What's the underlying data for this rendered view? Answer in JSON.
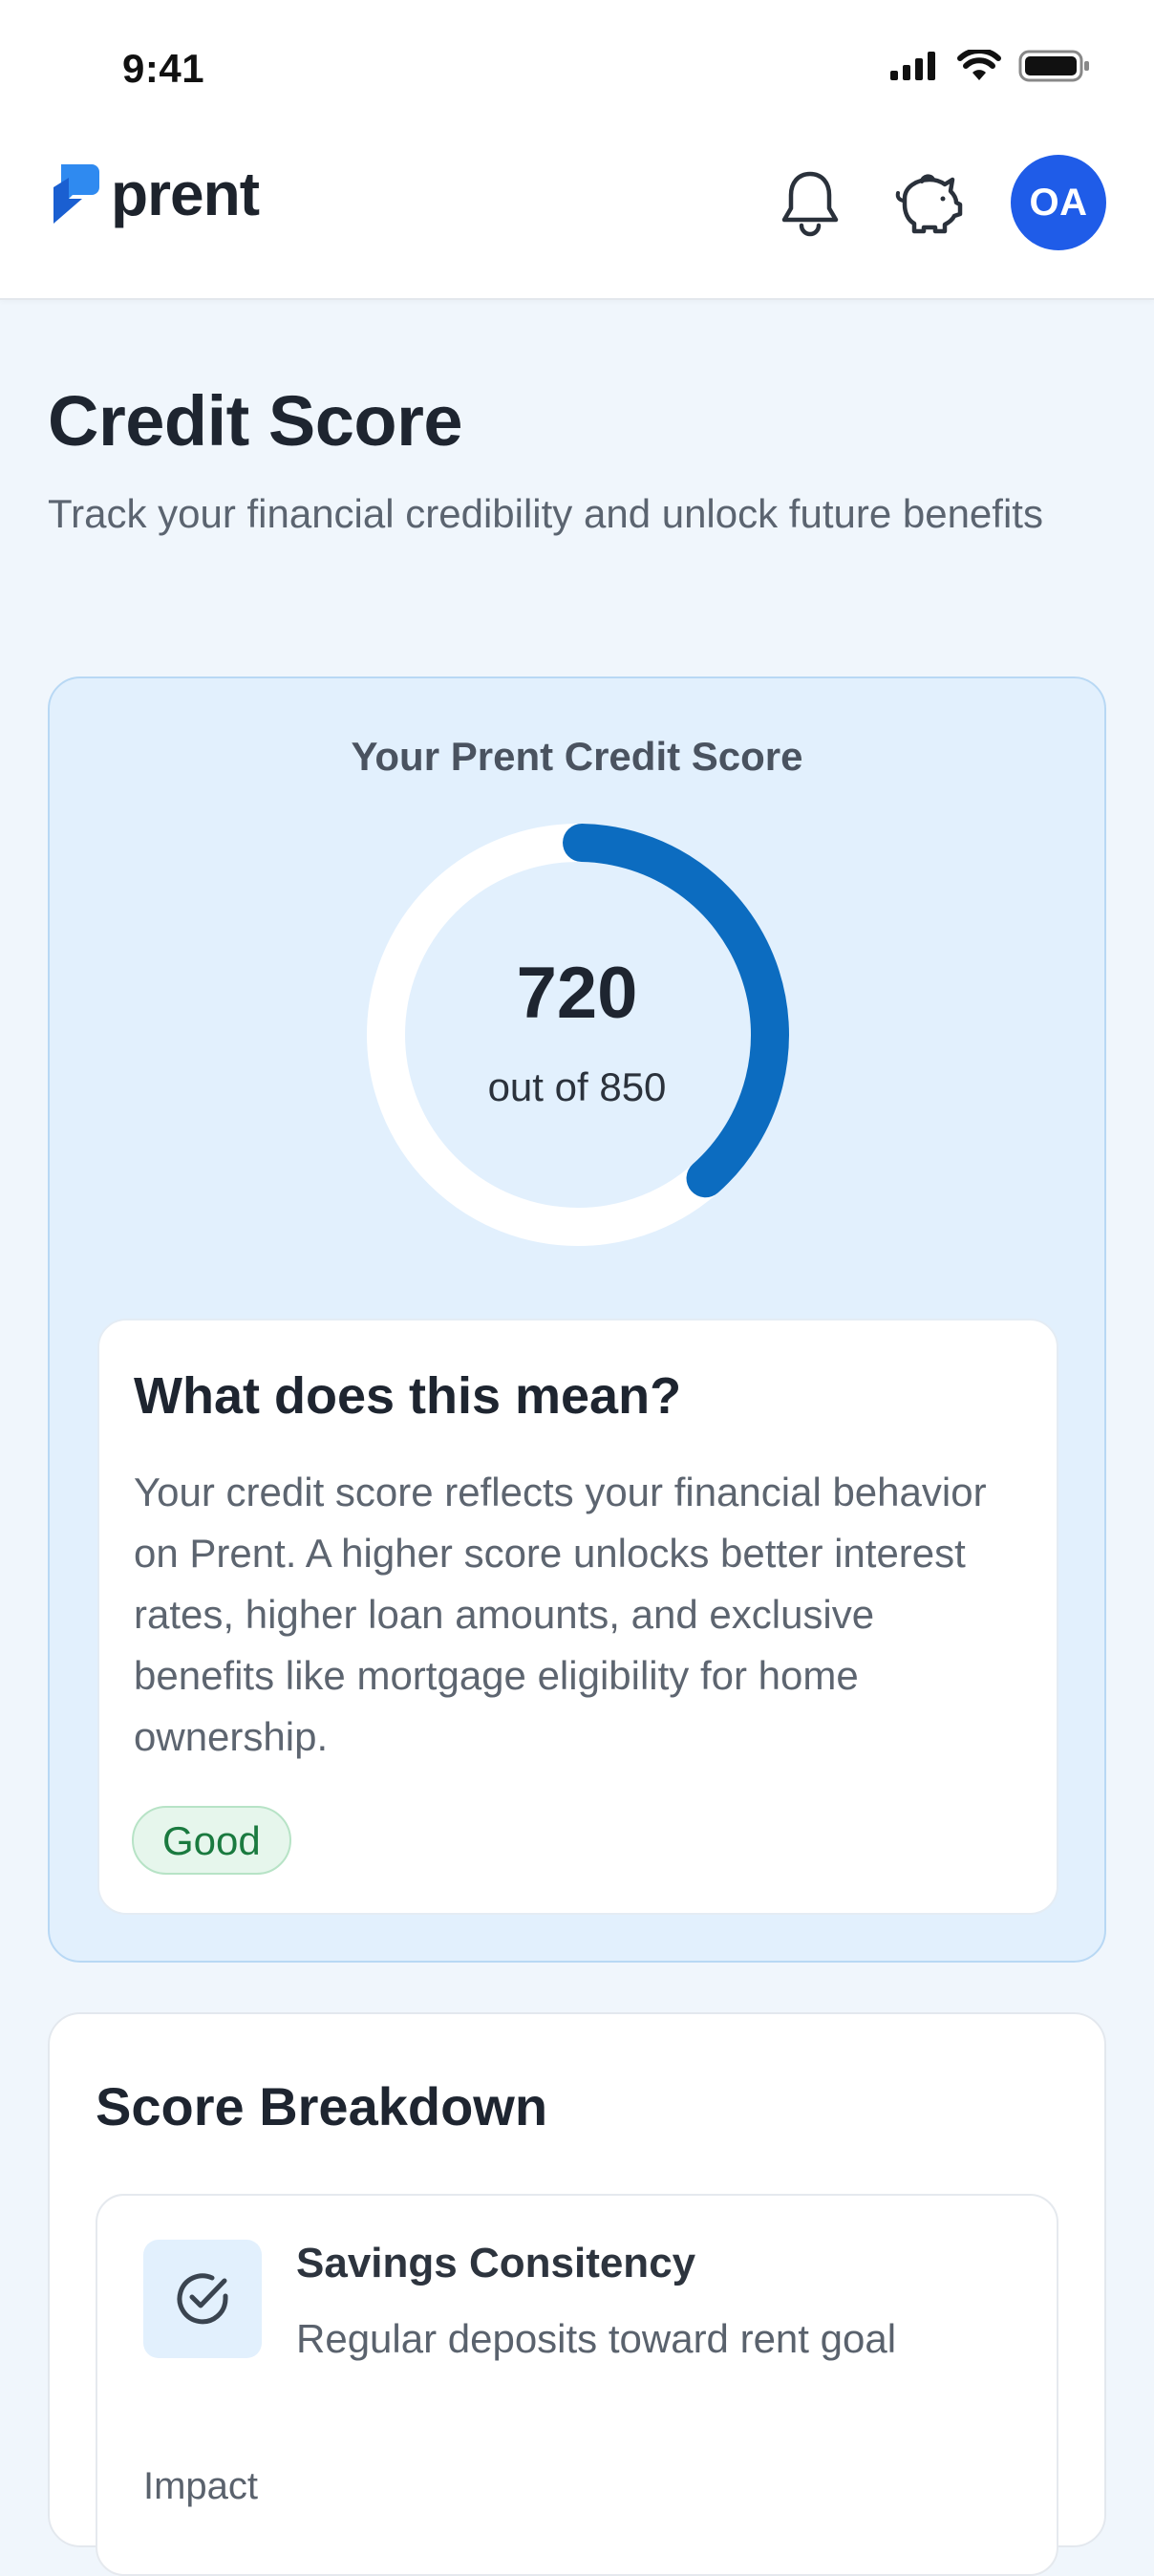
{
  "status_bar": {
    "time": "9:41"
  },
  "header": {
    "brand_name": "prent",
    "avatar_initials": "OA",
    "brand_color": "#1f5ce8"
  },
  "page": {
    "title": "Credit Score",
    "subtitle": "Track your financial credibility and unlock future benefits"
  },
  "score_card": {
    "title": "Your Prent Credit Score",
    "score": "720",
    "max_label": "out of 850",
    "score_value": 720,
    "score_max": 850,
    "arc_color": "#0c6cc0"
  },
  "meaning": {
    "title": "What does this mean?",
    "text": "Your credit score reflects your financial behavior on Prent. A higher score unlocks better interest rates, higher loan amounts, and exclusive benefits like mortgage eligibility for home ownership.",
    "badge": "Good"
  },
  "breakdown": {
    "title": "Score Breakdown",
    "factors": [
      {
        "name": "Savings Consitency",
        "description": "Regular deposits toward rent goal",
        "impact_label": "Impact",
        "icon": "check-circle-icon"
      }
    ]
  }
}
